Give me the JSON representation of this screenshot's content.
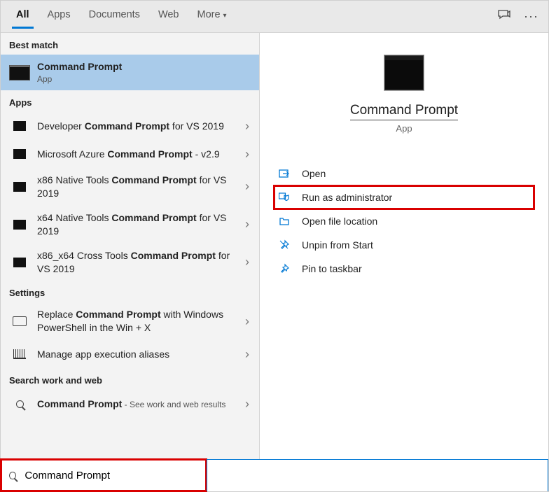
{
  "tabs": {
    "all": "All",
    "apps": "Apps",
    "documents": "Documents",
    "web": "Web",
    "more": "More"
  },
  "sections": {
    "best_match": "Best match",
    "apps": "Apps",
    "settings": "Settings",
    "search_web": "Search work and web"
  },
  "best": {
    "title": "Command Prompt",
    "subtitle": "App"
  },
  "apps_results": {
    "r1_pre": "Developer ",
    "r1_bold": "Command Prompt",
    "r1_post": " for VS 2019",
    "r2_pre": "Microsoft Azure ",
    "r2_bold": "Command Prompt",
    "r2_post": " - v2.9",
    "r3_pre": "x86 Native Tools ",
    "r3_bold": "Command Prompt",
    "r3_post": " for VS 2019",
    "r4_pre": "x64 Native Tools ",
    "r4_bold": "Command Prompt",
    "r4_post": " for VS 2019",
    "r5_pre": "x86_x64 Cross Tools ",
    "r5_bold": "Command Prompt",
    "r5_post": " for VS 2019"
  },
  "settings_results": {
    "s1_pre": "Replace ",
    "s1_bold": "Command Prompt",
    "s1_post": " with Windows PowerShell in the Win + X",
    "s2": "Manage app execution aliases"
  },
  "web_results": {
    "w1_bold": "Command Prompt",
    "w1_hint": " - See work and web results"
  },
  "preview": {
    "title": "Command Prompt",
    "subtitle": "App"
  },
  "actions": {
    "open": "Open",
    "run_admin": "Run as administrator",
    "open_loc": "Open file location",
    "unpin_start": "Unpin from Start",
    "pin_taskbar": "Pin to taskbar"
  },
  "search": {
    "value": "Command Prompt"
  }
}
